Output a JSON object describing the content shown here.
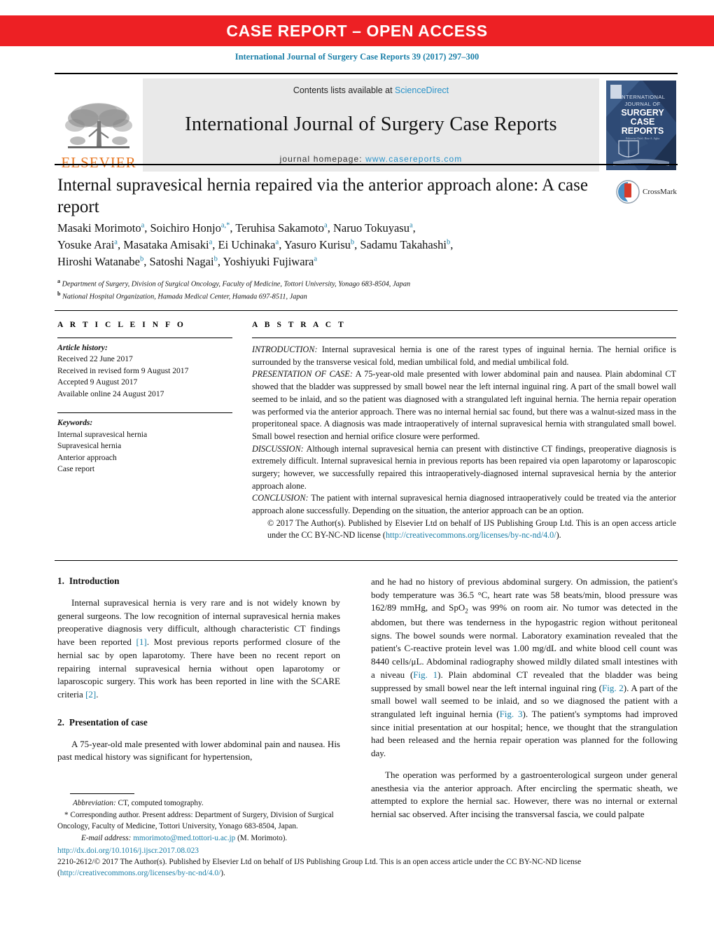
{
  "banner": {
    "text": "CASE REPORT – OPEN ACCESS",
    "bg_color": "#ed2024",
    "text_color": "#ffffff"
  },
  "running_citation": "International Journal of Surgery Case Reports 39 (2017) 297–300",
  "masthead": {
    "publisher_logo_word": "ELSEVIER",
    "publisher_logo_color": "#e87722",
    "contents_prefix": "Contents lists available at ",
    "contents_link": "ScienceDirect",
    "journal_title": "International Journal of Surgery Case Reports",
    "homepage_prefix": "journal homepage: ",
    "homepage_link": "www.casereports.com",
    "cover_lines": [
      "INTERNATIONAL",
      "JOURNAL OF",
      "SURGERY",
      "CASE",
      "REPORTS"
    ],
    "link_color": "#2a93c9",
    "band_bg": "#e9e9e9"
  },
  "article": {
    "title": "Internal supravesical hernia repaired via the anterior approach alone: A case report",
    "crossmark_label": "CrossMark",
    "authors_line_1": "Masaki Morimoto<sup>a</sup>, Soichiro Honjo<sup>a,*</sup>, Teruhisa Sakamoto<sup>a</sup>, Naruo Tokuyasu<sup>a</sup>,",
    "authors_line_2": "Yosuke Arai<sup>a</sup>, Masataka Amisaki<sup>a</sup>, Ei Uchinaka<sup>a</sup>, Yasuro Kurisu<sup>b</sup>, Sadamu Takahashi<sup>b</sup>,",
    "authors_line_3": "Hiroshi Watanabe<sup>b</sup>, Satoshi Nagai<sup>b</sup>, Yoshiyuki Fujiwara<sup>a</sup>",
    "affiliation_a": "<sup>a</sup> Department of Surgery, Division of Surgical Oncology, Faculty of Medicine, Tottori University, Yonago 683-8504, Japan",
    "affiliation_b": "<sup>b</sup> National Hospital Organization, Hamada Medical Center, Hamada 697-8511, Japan"
  },
  "article_info": {
    "heading": "A R T I C L E   I N F O",
    "history_label": "Article history:",
    "history": [
      "Received 22 June 2017",
      "Received in revised form 9 August 2017",
      "Accepted 9 August 2017",
      "Available online 24 August 2017"
    ],
    "keywords_label": "Keywords:",
    "keywords": [
      "Internal supravesical hernia",
      "Supravesical hernia",
      "Anterior approach",
      "Case report"
    ]
  },
  "abstract": {
    "heading": "A B S T R A C T",
    "introduction_label": "INTRODUCTION:",
    "introduction_text": " Internal supravesical hernia is one of the rarest types of inguinal hernia. The hernial orifice is surrounded by the transverse vesical fold, median umbilical fold, and medial umbilical fold.",
    "presentation_label": "PRESENTATION OF CASE:",
    "presentation_text": " A 75-year-old male presented with lower abdominal pain and nausea. Plain abdominal CT showed that the bladder was suppressed by small bowel near the left internal inguinal ring. A part of the small bowel wall seemed to be inlaid, and so the patient was diagnosed with a strangulated left inguinal hernia. The hernia repair operation was performed via the anterior approach. There was no internal hernial sac found, but there was a walnut-sized mass in the properitoneal space. A diagnosis was made intraoperatively of internal supravesical hernia with strangulated small bowel. Small bowel resection and hernial orifice closure were performed.",
    "discussion_label": "DISCUSSION:",
    "discussion_text": " Although internal supravesical hernia can present with distinctive CT findings, preoperative diagnosis is extremely difficult. Internal supravesical hernia in previous reports has been repaired via open laparotomy or laparoscopic surgery; however, we successfully repaired this intraoperatively-diagnosed internal supravesical hernia by the anterior approach alone.",
    "conclusion_label": "CONCLUSION:",
    "conclusion_text": " The patient with internal supravesical hernia diagnosed intraoperatively could be treated via the anterior approach alone successfully. Depending on the situation, the anterior approach can be an option.",
    "copyright_text": "© 2017 The Author(s). Published by Elsevier Ltd on behalf of IJS Publishing Group Ltd. This is an open access article under the CC BY-NC-ND license (",
    "copyright_link": "http://creativecommons.org/licenses/by-nc-nd/4.0/",
    "copyright_tail": ")."
  },
  "body": {
    "section_1_num": "1.",
    "section_1_title": "Introduction",
    "section_1_p1_a": "Internal supravesical hernia is very rare and is not widely known by general surgeons. The low recognition of internal supravesical hernia makes preoperative diagnosis very difficult, although characteristic CT findings have been reported ",
    "ref_1": "[1]",
    "section_1_p1_b": ". Most previous reports performed closure of the hernial sac by open laparotomy. There have been no recent report on repairing internal supravesical hernia without open laparotomy or laparoscopic surgery. This work has been reported in line with the SCARE criteria ",
    "ref_2": "[2]",
    "section_1_p1_c": ".",
    "section_2_num": "2.",
    "section_2_title": "Presentation of case",
    "section_2_p1": "A 75-year-old male presented with lower abdominal pain and nausea. His past medical history was significant for hypertension,",
    "right_p1_a": "and he had no history of previous abdominal surgery. On admission, the patient's body temperature was 36.5 °C, heart rate was 58 beats/min, blood pressure was 162/89 mmHg, and SpO",
    "right_p1_sub": "2",
    "right_p1_b": " was 99% on room air. No tumor was detected in the abdomen, but there was tenderness in the hypogastric region without peritoneal signs. The bowel sounds were normal. Laboratory examination revealed that the patient's C-reactive protein level was 1.00 mg/dL and white blood cell count was 8440 cells/μL. Abdominal radiography showed mildly dilated small intestines with a niveau (",
    "fig_1": "Fig. 1",
    "right_p1_c": "). Plain abdominal CT revealed that the bladder was being suppressed by small bowel near the left internal inguinal ring (",
    "fig_2": "Fig. 2",
    "right_p1_d": "). A part of the small bowel wall seemed to be inlaid, and so we diagnosed the patient with a strangulated left inguinal hernia (",
    "fig_3": "Fig. 3",
    "right_p1_e": "). The patient's symptoms had improved since initial presentation at our hospital; hence, we thought that the strangulation had been released and the hernia repair operation was planned for the following day.",
    "right_p2": "The operation was performed by a gastroenterological surgeon under general anesthesia via the anterior approach. After encircling the spermatic sheath, we attempted to explore the hernial sac. However, there was no internal or external hernial sac observed. After incising the transversal fascia, we could palpate"
  },
  "footnotes": {
    "abbrev_label": "Abbreviation:",
    "abbrev_text": " CT, computed tomography.",
    "corresponding": "* Corresponding author. Present address: Department of Surgery, Division of Surgical Oncology, Faculty of Medicine, Tottori University, Yonago 683-8504, Japan.",
    "email_label": "E-mail address:",
    "email_link": "mmorimoto@med.tottori-u.ac.jp",
    "email_tail": " (M. Morimoto)."
  },
  "bottom_meta": {
    "doi": "http://dx.doi.org/10.1016/j.ijscr.2017.08.023",
    "issn_line": "2210-2612/© 2017 The Author(s). Published by Elsevier Ltd on behalf of IJS Publishing Group Ltd. This is an open access article under the CC BY-NC-ND license (",
    "license_link_1": "http://",
    "license_link_2": "creativecommons.org/licenses/by-nc-nd/4.0/",
    "license_tail": ")."
  },
  "colors": {
    "link": "#1a7fa8",
    "accent_red": "#ed2024",
    "elsevier_orange": "#e87722",
    "band_gray": "#e9e9e9"
  }
}
